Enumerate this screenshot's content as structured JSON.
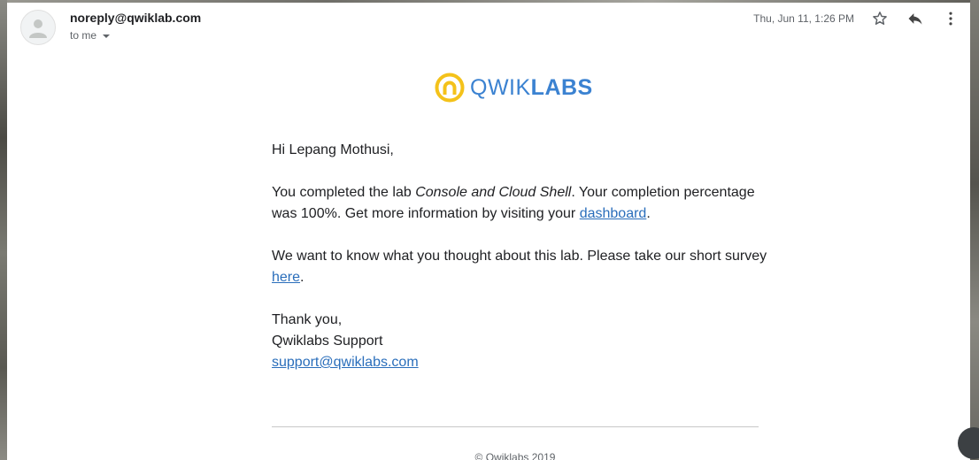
{
  "header": {
    "sender": "noreply@qwiklab.com",
    "recipient": "to me",
    "date": "Thu, Jun 11, 1:26 PM"
  },
  "icons": {
    "avatar": "person-icon",
    "star": "star-outline-icon",
    "reply": "reply-icon",
    "more": "more-vert-icon",
    "caret": "caret-down-icon"
  },
  "logo": {
    "light": "QWIK",
    "bold": "LABS",
    "brand_color": "#3b82d1",
    "mark_color": "#f4c21a"
  },
  "message": {
    "greeting": "Hi Lepang Mothusi,",
    "completed_prefix": "You completed the lab ",
    "lab_name": "Console and Cloud Shell",
    "completed_suffix": ". Your completion percentage was 100%. Get more information by visiting your ",
    "dashboard_link": "dashboard",
    "completed_end": ".",
    "survey_prefix": "We want to know what you thought about this lab. Please take our short survey ",
    "survey_link": "here",
    "survey_end": ".",
    "thanks": "Thank you,",
    "signature": "Qwiklabs Support",
    "support_email": "support@qwiklabs.com"
  },
  "footer": {
    "copyright": "© Qwiklabs 2019"
  },
  "colors": {
    "link": "#2a6ebb",
    "text": "#202124",
    "muted": "#5f6368"
  }
}
